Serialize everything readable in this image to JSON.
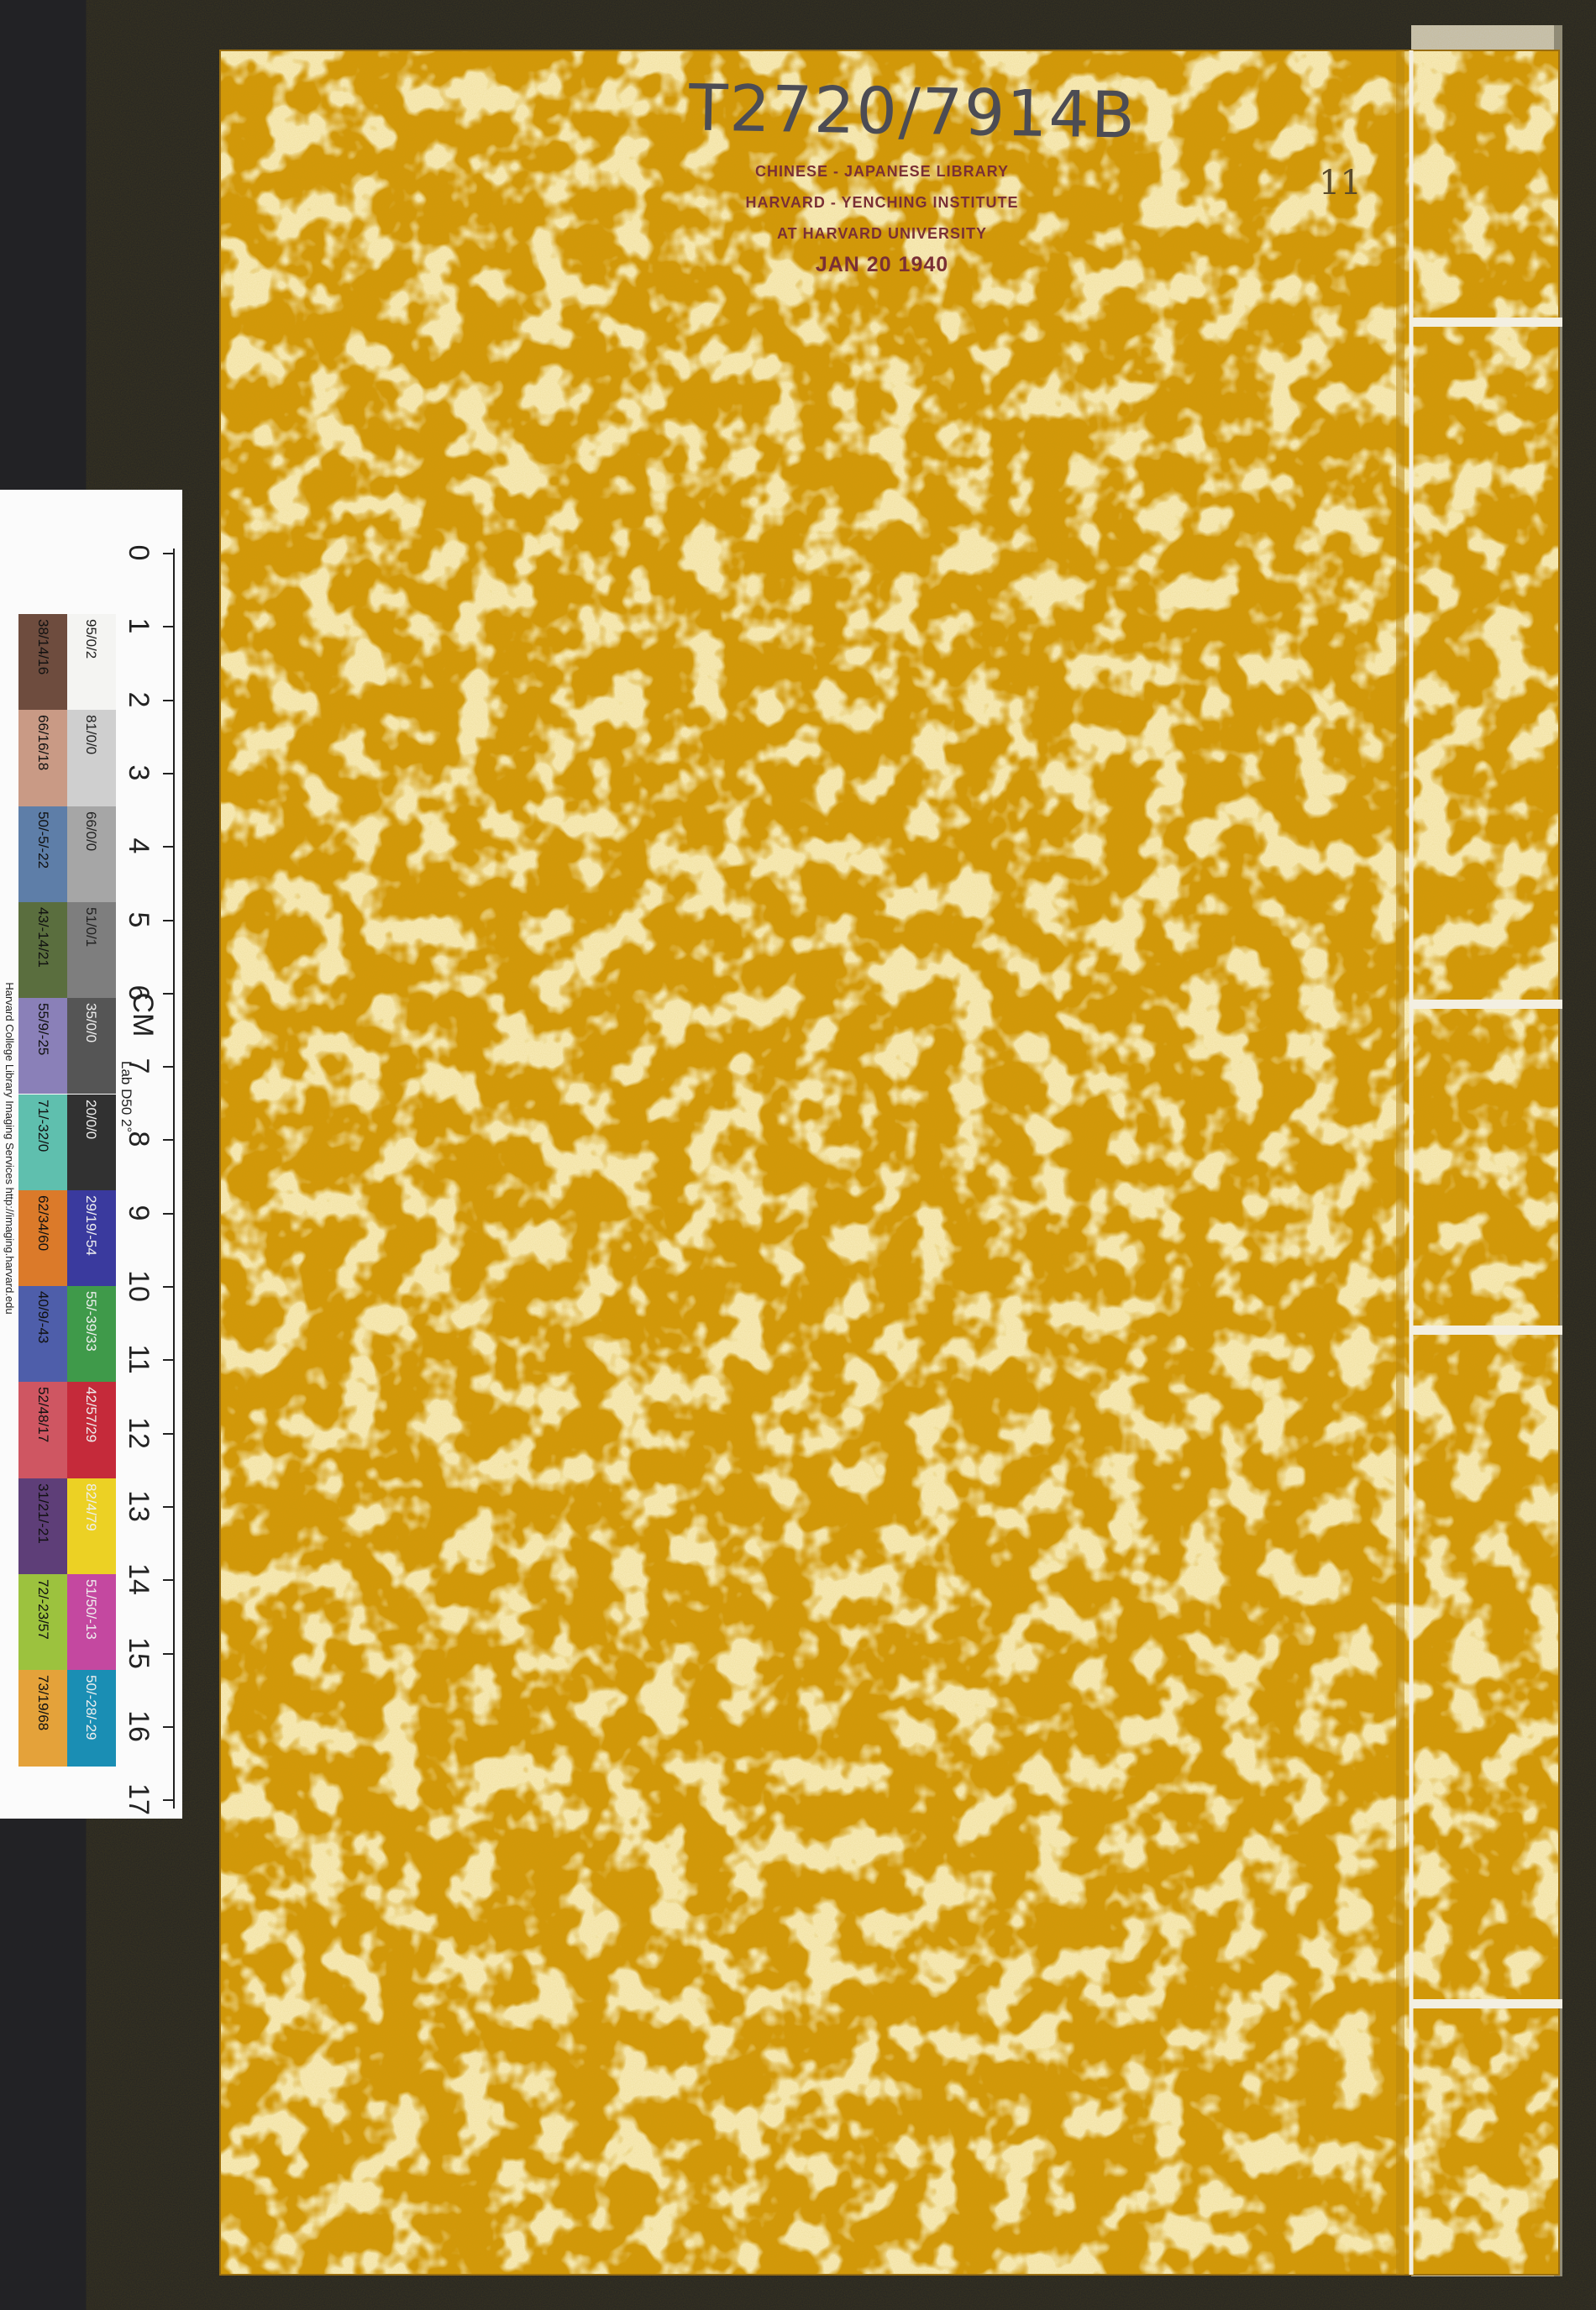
{
  "call_number": "T2720/7914B",
  "volume_mark": "11",
  "stamp": {
    "line1": "CHINESE - JAPANESE LIBRARY",
    "line2": "HARVARD - YENCHING INSTITUTE",
    "line3": "AT HARVARD UNIVERSITY",
    "date": "JAN 20 1940"
  },
  "color_target": {
    "credit": "Harvard College Library Imaging Services http://imaging.harvard.edu",
    "unit": "CM",
    "lab_label": "Lab D50 2°",
    "scale": [
      "0",
      "1",
      "2",
      "3",
      "4",
      "5",
      "6",
      "7",
      "8",
      "9",
      "10",
      "11",
      "12",
      "13",
      "14",
      "15",
      "16",
      "17"
    ],
    "gray_patches": [
      {
        "label": "95/0/2",
        "color": "#f4f4f2"
      },
      {
        "label": "81/0/0",
        "color": "#cfcfcf"
      },
      {
        "label": "66/0/0",
        "color": "#a6a6a6"
      },
      {
        "label": "51/0/1",
        "color": "#7e7e7e"
      },
      {
        "label": "35/0/0",
        "color": "#555555"
      },
      {
        "label": "20/0/0",
        "color": "#313131"
      },
      {
        "label": "29/19/-54",
        "color": "#3a3a9e"
      },
      {
        "label": "55/-39/33",
        "color": "#3f9a4a"
      },
      {
        "label": "42/57/29",
        "color": "#c52a3a"
      },
      {
        "label": "82/4/79",
        "color": "#ecd124"
      },
      {
        "label": "51/50/-13",
        "color": "#c448a0"
      },
      {
        "label": "50/-28/-29",
        "color": "#1a8eb4"
      }
    ],
    "color_patches": [
      {
        "label": "38/14/16",
        "color": "#6e4c3e"
      },
      {
        "label": "66/16/18",
        "color": "#c99a85"
      },
      {
        "label": "50/-5/-22",
        "color": "#5e7ea8"
      },
      {
        "label": "43/-14/21",
        "color": "#5a6e3e"
      },
      {
        "label": "55/9/-25",
        "color": "#8a80b8"
      },
      {
        "label": "71/-32/0",
        "color": "#5fbfae"
      },
      {
        "label": "62/34/60",
        "color": "#db7a2a"
      },
      {
        "label": "40/9/-43",
        "color": "#4e5eaa"
      },
      {
        "label": "52/48/17",
        "color": "#cf5662"
      },
      {
        "label": "31/21/-21",
        "color": "#5e3e78"
      },
      {
        "label": "72/-23/57",
        "color": "#9cc23e"
      },
      {
        "label": "73/19/68",
        "color": "#e4a23a"
      }
    ]
  },
  "colors": {
    "cover_base": "#d4980a",
    "cover_spot": "#f4db85",
    "background": "#222225",
    "stamp_ink": "#7a2f35"
  }
}
